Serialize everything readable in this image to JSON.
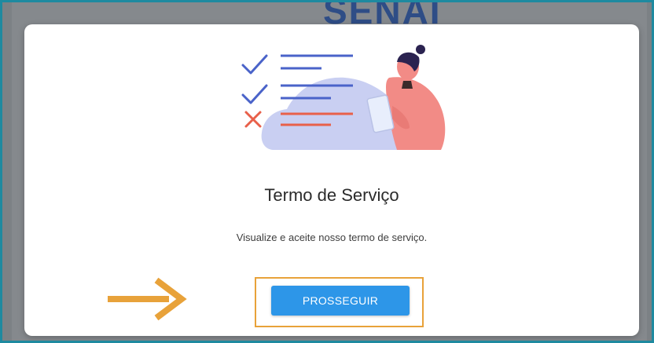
{
  "background": {
    "logo_text": "SENAI"
  },
  "modal": {
    "title": "Termo de Serviço",
    "subtitle": "Visualize e aceite nosso termo de serviço.",
    "button_label": "PROSSEGUIR"
  },
  "colors": {
    "button": "#2d96e8",
    "highlight": "#e8a23a",
    "check": "#4a63c9",
    "cross": "#e8604a",
    "blob": "#c9cff2",
    "person_shirt": "#f28b86"
  },
  "icons": {
    "arrow": "arrow-right-icon",
    "checks": [
      "check-icon",
      "check-icon"
    ],
    "cross": "x-icon"
  }
}
